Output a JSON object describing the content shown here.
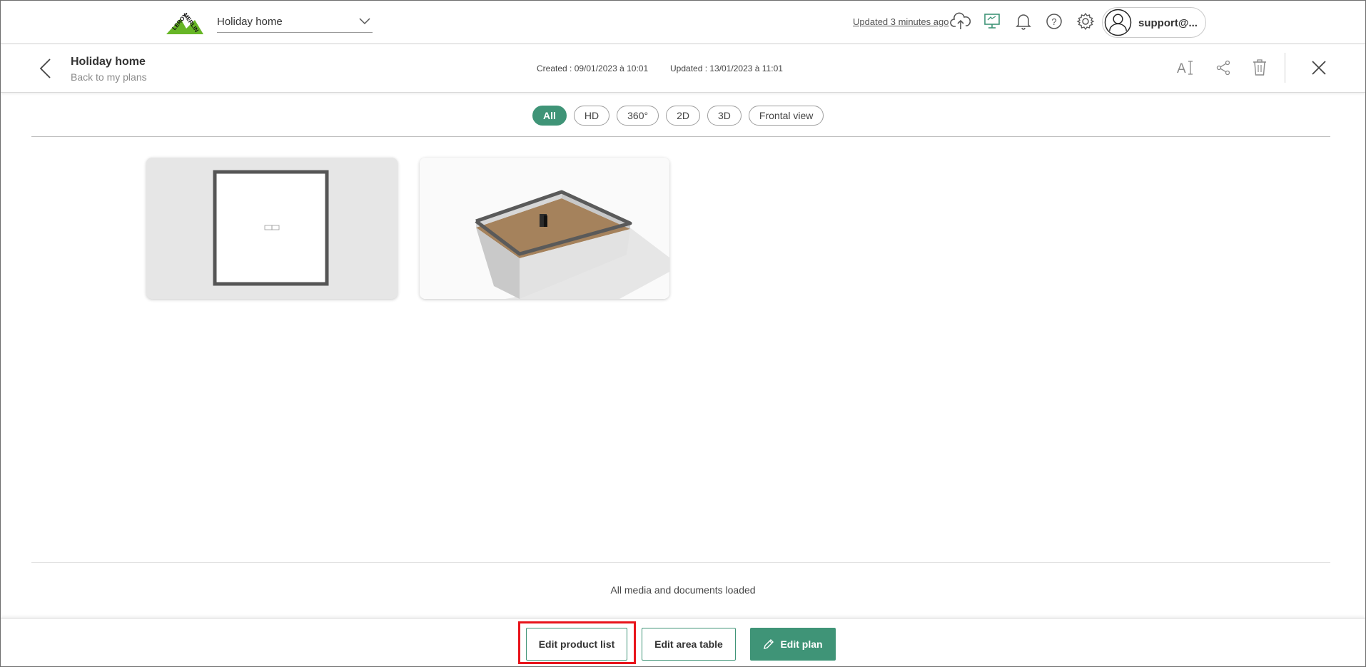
{
  "topbar": {
    "project_name": "Holiday home",
    "updated_link": "Updated 3 minutes ago",
    "user_name": "support@...",
    "icons": [
      "cloud-upload-icon",
      "monitor-icon",
      "bell-icon",
      "help-icon",
      "gear-icon",
      "user-avatar-icon"
    ]
  },
  "plan_header": {
    "title": "Holiday home",
    "back_label": "Back to my plans",
    "created": "Created : 09/01/2023 à 10:01",
    "updated": "Updated : 13/01/2023 à 11:01",
    "icons": [
      "text-size-icon",
      "share-icon",
      "trash-icon",
      "close-icon"
    ]
  },
  "filters": [
    {
      "label": "All",
      "active": true
    },
    {
      "label": "HD",
      "active": false
    },
    {
      "label": "360°",
      "active": false
    },
    {
      "label": "2D",
      "active": false
    },
    {
      "label": "3D",
      "active": false
    },
    {
      "label": "Frontal view",
      "active": false
    }
  ],
  "media": [
    {
      "kind": "2D plan"
    },
    {
      "kind": "3D view"
    }
  ],
  "status_text": "All media and documents loaded",
  "footer": {
    "edit_product_list": "Edit product list",
    "edit_area_table": "Edit area table",
    "edit_plan": "Edit plan"
  },
  "colors": {
    "accent": "#3f9477",
    "highlight": "#e8141b",
    "brand_green": "#67b626"
  }
}
